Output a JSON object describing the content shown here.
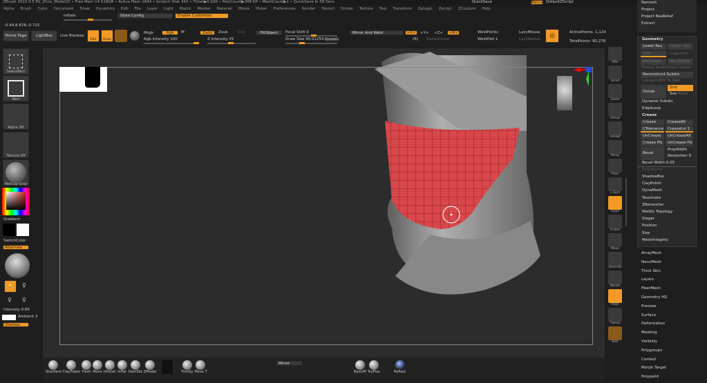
{
  "title": "ZBrush 2022.0.5 Ed_Zhou_Model20 • Free Mem 14.519GB • Active Mem 1844 • Scratch Disk 342 • Timer▶0.026 • PolyCount▶288 KP • MeshCount▶1 • QuickSave In 58 Secs",
  "topright": {
    "quicksave": "QuickSave",
    "menus": "Menus",
    "script": "DefaultZScript"
  },
  "menus": [
    "Alpha",
    "Brush",
    "Color",
    "Document",
    "Draw",
    "Dynamics",
    "Edit",
    "File",
    "Layer",
    "Light",
    "Macro",
    "Marker",
    "Material",
    "Movie",
    "Picker",
    "Preferences",
    "Render",
    "Stencil",
    "Stroke",
    "Texture",
    "Tool",
    "Transform",
    "Zplugin",
    "Zscript",
    "ZCouture",
    "Help"
  ],
  "toolbar": {
    "inflate": "Inflate",
    "store_config": "Store Config",
    "enable_customize": "Enable Customize",
    "coords": "-5.44,8.878,-0.715",
    "home": "Home Page",
    "lightbox": "LightBox",
    "live_boolean": "Live Boolean",
    "edit": "Edit",
    "draw": "Draw",
    "mrgb": "Mrgb",
    "rgb": "Rgb",
    "m": "M",
    "zadd": "Zadd",
    "zsub": "Zsub",
    "zcut": "Zcut",
    "rgb_intensity": "Rgb Intensity 100",
    "z_intensity": "Z Intensity 25",
    "fillobject": "FillObject",
    "focal_shift": "Focal Shift 0",
    "draw_size": "Draw Size 90.01259",
    "dynamic": "Dynamic",
    "mirror_weld": "Mirror And Weld",
    "x": ">X<",
    "y": ">Y<",
    "z": ">Z<",
    "m_axis": ">M<",
    "r": "(R)",
    "radial": "RadialCount",
    "weldpoints": "WeldPoints",
    "welddist": "WeldDist 1",
    "lazymouse": "LazyMouse",
    "lazyradius": "LazyRadius",
    "active_points": "ActivePoints: 1,124",
    "total_points": "TotalPoints: 90,278"
  },
  "left": {
    "tiles": [
      "SelectRect",
      "Rect",
      "Alpha Off",
      "Texture Off",
      "MatCap Gray"
    ],
    "gradient": "Gradient",
    "switchcolor": "SwitchColor",
    "alternate": "Alternate",
    "intensity": "Intensity 0.85",
    "ambient": "Ambient 3",
    "shadow": "Shadow"
  },
  "shelf": [
    "SPix",
    "Scroll",
    "Zoom",
    "Actual",
    "AAHalf",
    "Persp",
    "Floor",
    "L.Sym",
    "Gxyz",
    "Frame",
    "Move",
    "Zoom3D",
    "Rotate",
    "PolyF",
    "Transp",
    "Solo"
  ],
  "panel_top": [
    "Remesh",
    "Project",
    "Project BasRelief",
    "Extract"
  ],
  "geometry": {
    "title": "Geometry",
    "lower_res": "Lower Res",
    "higher_res": "Higher Res",
    "sdiv": "SDiv",
    "cage": "Cage",
    "rstr": "Rstr",
    "del_lower": "Del Lower",
    "del_higher": "Del Higher",
    "freeze": "Freeze SubDivision Levels",
    "reconstruct": "Reconstruct Subdiv",
    "convert": "Convert BPR To Geo",
    "divide": "Divide",
    "smt": "Smt",
    "suv": "Suv",
    "rply": "ReUV",
    "dynamic_subdiv": "Dynamic Subdiv",
    "edgeloop": "EdgeLoop",
    "crease_head": "Crease",
    "crease": "Crease",
    "creaseall": "CreaseAll",
    "ctolerance": "CTolerance 45",
    "creaselvl": "CreaseLvl 1",
    "uncrease": "UnCrease",
    "uncreaseall": "UnCreaseAll",
    "creasepg": "Crease PG",
    "uncreasepg": "UnCrease PG",
    "bevel": "Bevel",
    "propwidth": "PropWidth",
    "resolution": "Resolution 0",
    "bevel_width": "Bevel Width 0.05",
    "edgebevel": "EdgeBevel",
    "items": [
      "ShadowBox",
      "ClayPolish",
      "DynaMesh",
      "Tessimate",
      "ZRemesher",
      "Modify Topology",
      "Stager",
      "Position",
      "Size",
      "MeshIntegrity"
    ]
  },
  "subpalettes": [
    "ArrayMesh",
    "NanoMesh",
    "Thick Skin",
    "Layers",
    "FiberMesh",
    "Geometry HD",
    "Preview",
    "Surface",
    "Deformation",
    "Masking",
    "Visibility",
    "Polygroups",
    "Contact",
    "Morph Target",
    "Polypaint"
  ],
  "bottom": {
    "brushes": [
      "Standard",
      "ClayTubes",
      "Flesh",
      "Move",
      "hPolish",
      "Inflat",
      "DamStd",
      "ZModel"
    ],
    "brushes2": [
      "TrimDy",
      "Move T"
    ],
    "mirror": "Mirror",
    "brushes3": [
      "BasicM",
      "ToyPlas"
    ],
    "reflect": "Reflect"
  },
  "colors": {
    "accent": "#f29a25",
    "mesh_red": "#d9474a"
  }
}
